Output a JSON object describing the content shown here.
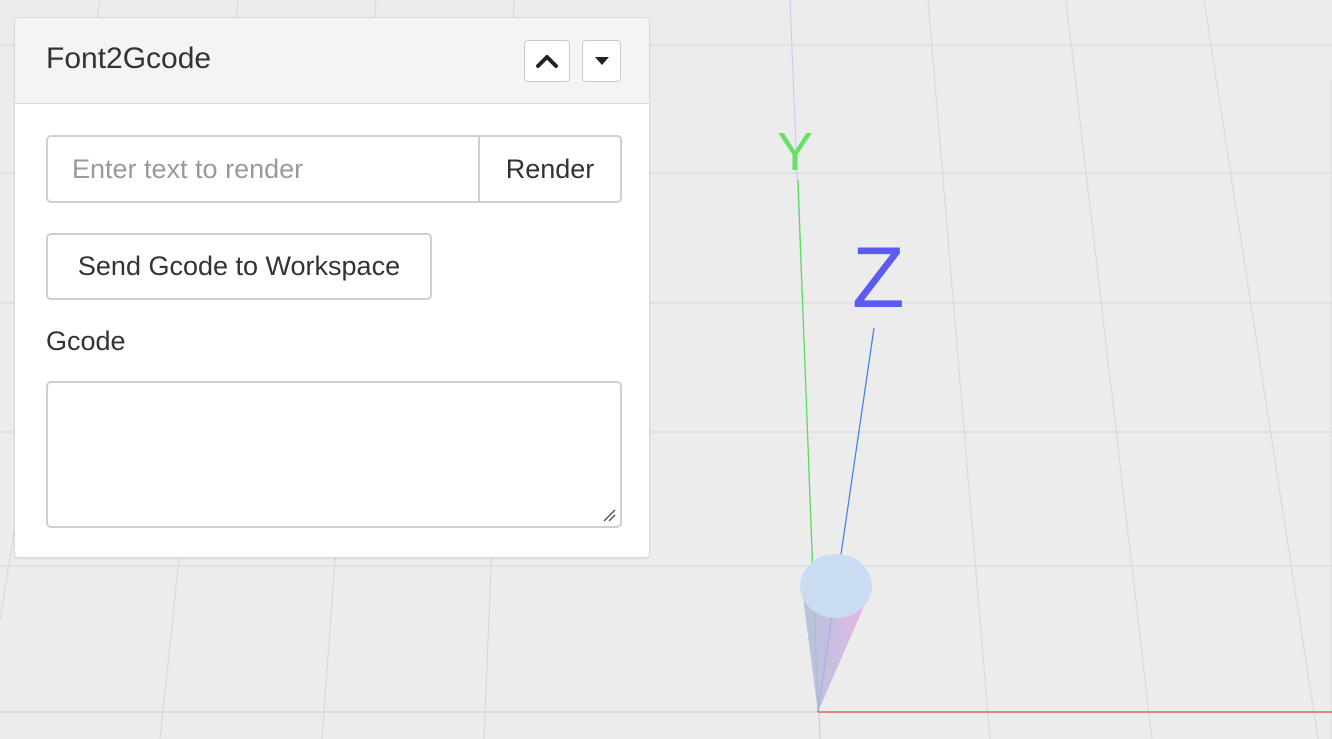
{
  "panel": {
    "title": "Font2Gcode",
    "collapse_icon": "chevron-up-icon",
    "menu_icon": "caret-down-icon"
  },
  "form": {
    "text_placeholder": "Enter text to render",
    "text_value": "",
    "render_label": "Render",
    "send_label": "Send Gcode to Workspace",
    "gcode_label": "Gcode",
    "gcode_value": ""
  },
  "viewport": {
    "axis_labels": {
      "y": "Y",
      "z": "Z"
    },
    "colors": {
      "x_axis": "#e06060",
      "y_axis": "#55dd55",
      "z_axis": "#5b5bf0",
      "z_line": "#3a7cf0",
      "background": "#ececec",
      "grid": "#d6d6d6"
    }
  }
}
